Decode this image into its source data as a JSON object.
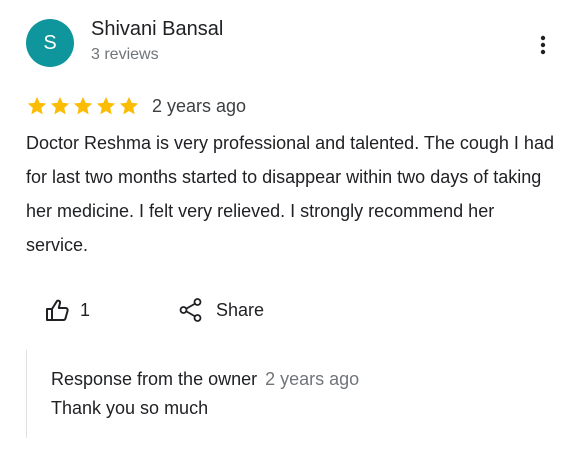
{
  "review": {
    "author": {
      "initial": "S",
      "name": "Shivani Bansal",
      "meta": "3 reviews",
      "avatar_color": "#0f969c"
    },
    "more_icon": "more-vert-icon",
    "rating": {
      "stars": 5,
      "max": 5,
      "star_color": "#fbbc04",
      "date": "2 years ago"
    },
    "text": "Doctor Reshma is very professional and talented. The cough I had for last two months started to disappear within two days of taking her medicine. I felt very relieved. I strongly recommend her service.",
    "actions": {
      "like_icon": "thumbs-up-icon",
      "like_count": "1",
      "share_icon": "share-icon",
      "share_label": "Share"
    },
    "owner_response": {
      "title": "Response from the owner",
      "date": "2 years ago",
      "text": "Thank you so much"
    }
  }
}
